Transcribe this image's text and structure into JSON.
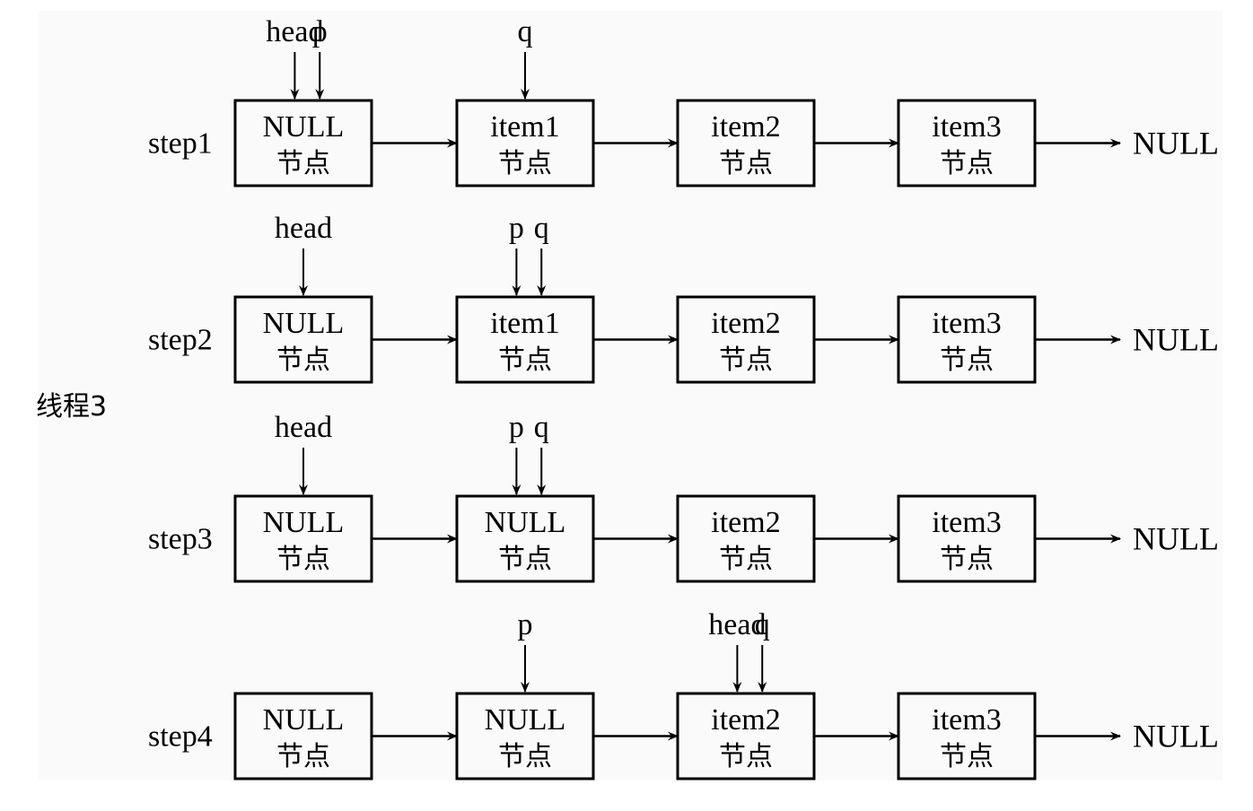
{
  "thread_label": "线程3",
  "node_sub_label": "节点",
  "terminal_label": "NULL",
  "steps": [
    {
      "label": "step1",
      "nodes": [
        "NULL",
        "item1",
        "item2",
        "item3"
      ],
      "pointers": [
        {
          "name": "head",
          "node": 0,
          "slot": "left"
        },
        {
          "name": "p",
          "node": 0,
          "slot": "right"
        },
        {
          "name": "q",
          "node": 1,
          "slot": "center"
        }
      ]
    },
    {
      "label": "step2",
      "nodes": [
        "NULL",
        "item1",
        "item2",
        "item3"
      ],
      "pointers": [
        {
          "name": "head",
          "node": 0,
          "slot": "center"
        },
        {
          "name": "p",
          "node": 1,
          "slot": "left"
        },
        {
          "name": "q",
          "node": 1,
          "slot": "right"
        }
      ]
    },
    {
      "label": "step3",
      "nodes": [
        "NULL",
        "NULL",
        "item2",
        "item3"
      ],
      "pointers": [
        {
          "name": "head",
          "node": 0,
          "slot": "center"
        },
        {
          "name": "p",
          "node": 1,
          "slot": "left"
        },
        {
          "name": "q",
          "node": 1,
          "slot": "right"
        }
      ]
    },
    {
      "label": "step4",
      "nodes": [
        "NULL",
        "NULL",
        "item2",
        "item3"
      ],
      "pointers": [
        {
          "name": "p",
          "node": 1,
          "slot": "center"
        },
        {
          "name": "head",
          "node": 2,
          "slot": "left"
        },
        {
          "name": "q",
          "node": 2,
          "slot": "right"
        }
      ]
    }
  ]
}
